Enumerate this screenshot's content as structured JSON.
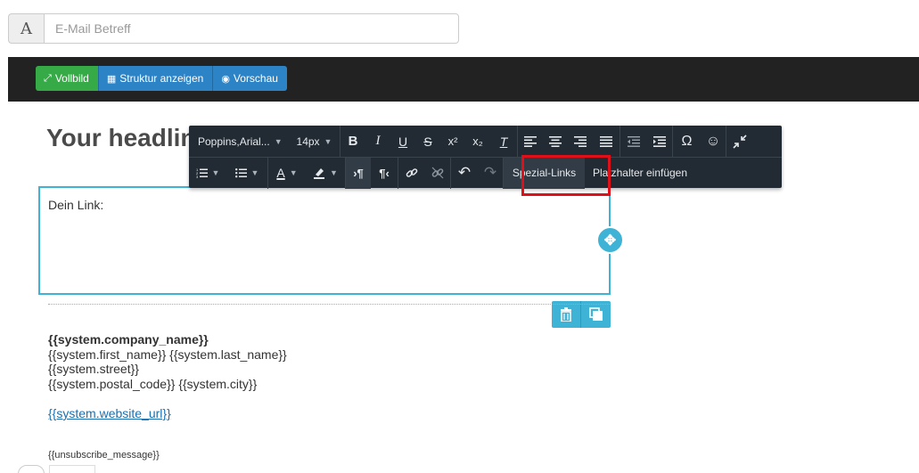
{
  "subject": {
    "addon_label": "A",
    "placeholder": "E-Mail Betreff",
    "value": ""
  },
  "topbar": {
    "fullscreen_label": "Vollbild",
    "structure_label": "Struktur anzeigen",
    "preview_label": "Vorschau",
    "colors": {
      "green": "#35aa47",
      "blue": "#2c83c5",
      "bar": "#222222"
    }
  },
  "content": {
    "heading": "Your headline",
    "edit_text": "Dein Link:"
  },
  "footer": {
    "company": "{{system.company_name}}",
    "name_line": "{{system.first_name}} {{system.last_name}}",
    "street": "{{system.street}}",
    "city_line": "{{system.postal_code}} {{system.city}}",
    "website": "{{system.website_url}}",
    "unsubscribe": "{{unsubscribe_message}}"
  },
  "toolbar": {
    "font_family": "Poppins,Arial...",
    "font_size": "14px",
    "special_links": "Spezial-Links",
    "insert_placeholder": "Platzhalter einfügen",
    "icons": [
      "bold-icon",
      "italic-icon",
      "underline-icon",
      "strikethrough-icon",
      "superscript-icon",
      "subscript-icon",
      "clear-format-icon",
      "align-left-icon",
      "align-center-icon",
      "align-right-icon",
      "align-justify-icon",
      "outdent-icon",
      "indent-icon",
      "special-character-icon",
      "emoticon-icon",
      "collapse-icon",
      "ordered-list-icon",
      "unordered-list-icon",
      "text-color-icon",
      "background-color-icon",
      "ltr-icon",
      "rtl-icon",
      "link-icon",
      "unlink-icon",
      "undo-icon",
      "redo-icon"
    ]
  },
  "highlight_color": "#e0101a"
}
